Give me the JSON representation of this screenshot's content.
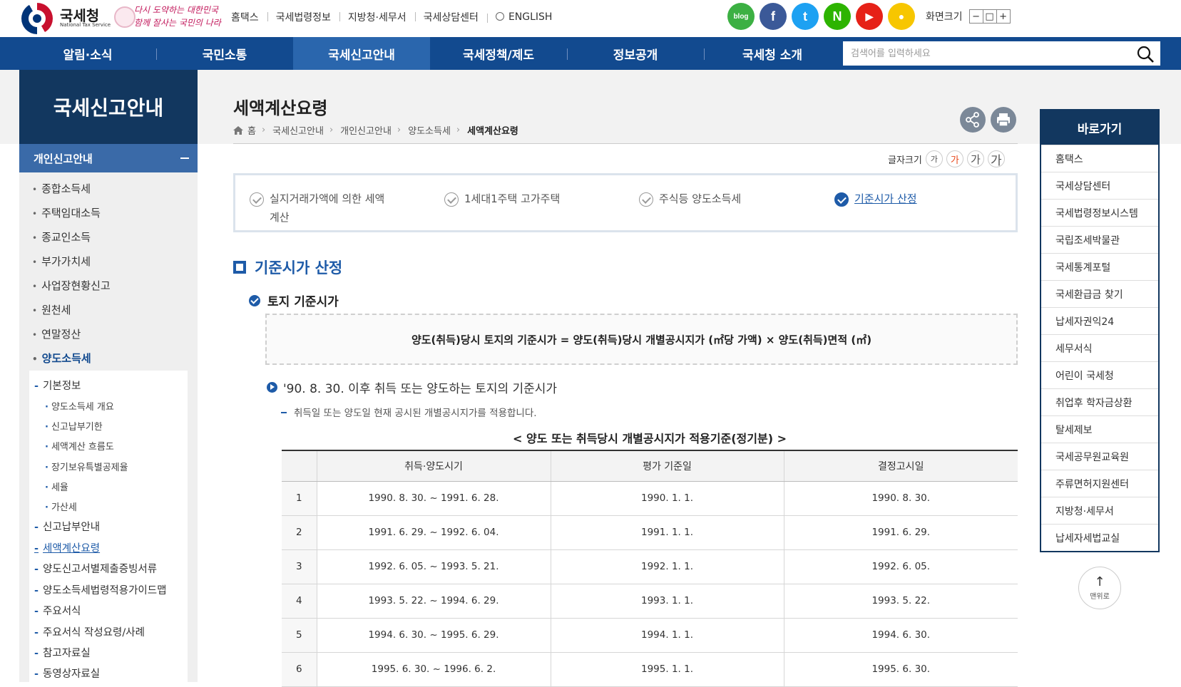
{
  "header": {
    "logo_name": "국세청",
    "logo_sub": "National Tax Service",
    "slogan_line1": "다시 도약하는 대한민국",
    "slogan_line2": "함께 잘사는 국민의 나라",
    "utility_links": [
      "홈택스",
      "국세법령정보",
      "지방청·세무서",
      "국세상담센터",
      "ENGLISH"
    ],
    "social": [
      {
        "name": "blog",
        "label": "blog",
        "color": "#3cb043"
      },
      {
        "name": "facebook",
        "label": "f",
        "color": "#3b5998"
      },
      {
        "name": "twitter",
        "label": "t",
        "color": "#1da1f2"
      },
      {
        "name": "naver-post",
        "label": "N",
        "color": "#2db400"
      },
      {
        "name": "youtube",
        "label": "▶",
        "color": "#e62117"
      },
      {
        "name": "kakao",
        "label": "●",
        "color": "#f7c600"
      }
    ],
    "screen_size_label": "화면크기",
    "screen_size_buttons": [
      "−",
      "□",
      "+"
    ]
  },
  "gnb": {
    "menus": [
      "알림·소식",
      "국민소통",
      "국세신고안내",
      "국세정책/제도",
      "정보공개",
      "국세청 소개"
    ],
    "active_index": 2,
    "search_placeholder": "검색어를 입력하세요"
  },
  "lnb": {
    "title": "국세신고안내",
    "sub_title": "개인신고안내",
    "items": [
      "종합소득세",
      "주택임대소득",
      "종교인소득",
      "부가가치세",
      "사업장현황신고",
      "원천세",
      "연말정산",
      "양도소득세"
    ],
    "active_item": "양도소득세",
    "sub_items": [
      "기본정보",
      "신고납부안내",
      "세액계산요령",
      "양도신고서별제출증빙서류",
      "양도소득세법령적용가이드맵",
      "주요서식",
      "주요서식 작성요령/사례",
      "참고자료실",
      "동영상자료실"
    ],
    "sub_sub_items": [
      "양도소득세 개요",
      "신고납부기한",
      "세액계산 흐름도",
      "장기보유특별공제율",
      "세율",
      "가산세"
    ],
    "active_sub_item": "세액계산요령"
  },
  "content": {
    "title": "세액계산요령",
    "breadcrumb": [
      "홈",
      "국세신고안내",
      "개인신고안내",
      "양도소득세",
      "세액계산요령"
    ],
    "font_size_label": "글자크기",
    "font_size_buttons": [
      "가",
      "가",
      "가",
      "가"
    ],
    "tabs": [
      {
        "label": "실지거래가액에 의한 세액계산",
        "active": false
      },
      {
        "label": "1세대1주택 고가주택",
        "active": false
      },
      {
        "label": "주식등 양도소득세",
        "active": false
      },
      {
        "label": "기준시가 산정",
        "active": true
      }
    ],
    "section_title": "기준시가 산정",
    "sub_title": "토지 기준시가",
    "formula": "양도(취득)당시 토지의 기준시가 = 양도(취득)당시 개별공시지가 (㎡당 가액) × 양도(취득)면적 (㎡)",
    "h3": "'90. 8. 30. 이후 취득 또는 양도하는 토지의 기준시가",
    "note": "취득일 또는 양도일 현재 공시된 개별공시지가를 적용합니다.",
    "table_caption": "< 양도 또는 취득당시 개별공시지가 적용기준(정기분) >",
    "table_headers": [
      "",
      "취득·양도시기",
      "평가 기준일",
      "결정고시일"
    ],
    "table_rows": [
      [
        "1",
        "1990. 8. 30. ~ 1991. 6. 28.",
        "1990. 1. 1.",
        "1990. 8. 30."
      ],
      [
        "2",
        "1991. 6. 29. ~ 1992. 6. 04.",
        "1991. 1. 1.",
        "1991. 6. 29."
      ],
      [
        "3",
        "1992. 6. 05. ~ 1993. 5. 21.",
        "1992. 1. 1.",
        "1992. 6. 05."
      ],
      [
        "4",
        "1993. 5. 22. ~ 1994. 6. 29.",
        "1993. 1. 1.",
        "1993. 5. 22."
      ],
      [
        "5",
        "1994. 6. 30. ~ 1995. 6. 29.",
        "1994. 1. 1.",
        "1994. 6. 30."
      ],
      [
        "6",
        "1995. 6. 30. ~ 1996. 6. 2.",
        "1995. 1. 1.",
        "1995. 6. 30."
      ]
    ]
  },
  "quick": {
    "title": "바로가기",
    "links": [
      "홈택스",
      "국세상담센터",
      "국세법령정보시스템",
      "국립조세박물관",
      "국세통계포털",
      "국세환급금 찾기",
      "납세자권익24",
      "세무서식",
      "어린이 국세청",
      "취업후 학자금상환",
      "탈세제보",
      "국세공무원교육원",
      "주류면허지원센터",
      "지방청·세무서",
      "납세자세법교실"
    ],
    "to_top": "맨위로"
  },
  "colors": {
    "gnb_bg": "#124a8f",
    "gnb_active": "#2a66ad",
    "lnb_title_bg": "#12375f",
    "lnb_sub_bg": "#3a6aa8",
    "accent_blue": "#1e5ba8",
    "font_size_active": "#e8491d"
  }
}
